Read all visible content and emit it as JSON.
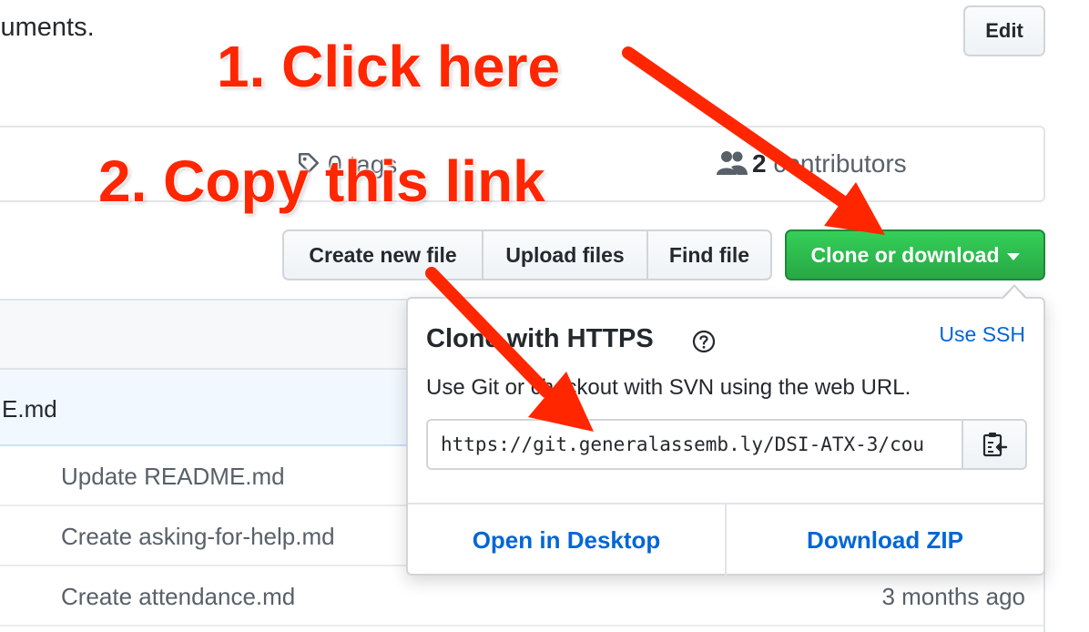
{
  "repo": {
    "description_fragment": "cuments.",
    "edit_label": "Edit"
  },
  "summary": {
    "tags_text": "0 tags",
    "contributors_count": "2",
    "contributors_label": "contributors"
  },
  "actions": {
    "create_new_file": "Create new file",
    "upload_files": "Upload files",
    "find_file": "Find file",
    "clone_or_download": "Clone or download"
  },
  "files": {
    "rows": [
      {
        "name": "E.md",
        "message": "",
        "age": ""
      },
      {
        "name": "",
        "message": "Update README.md",
        "age": ""
      },
      {
        "name": "",
        "message": "Create asking-for-help.md",
        "age": ""
      },
      {
        "name": "",
        "message": "Create attendance.md",
        "age": "3 months ago"
      }
    ]
  },
  "clone_dropdown": {
    "title": "Clone with HTTPS",
    "use_ssh": "Use SSH",
    "description": "Use Git or checkout with SVN using the web URL.",
    "url": "https://git.generalassemb.ly/DSI-ATX-3/cou",
    "open_in_desktop": "Open in Desktop",
    "download_zip": "Download ZIP"
  },
  "annotations": {
    "step1": "1. Click here",
    "step2": "2. Copy this link",
    "color": "#ff2600"
  },
  "colors": {
    "primary_green": "#28a745",
    "link_blue": "#0366d6",
    "highlight_row": "#f1f8ff"
  }
}
